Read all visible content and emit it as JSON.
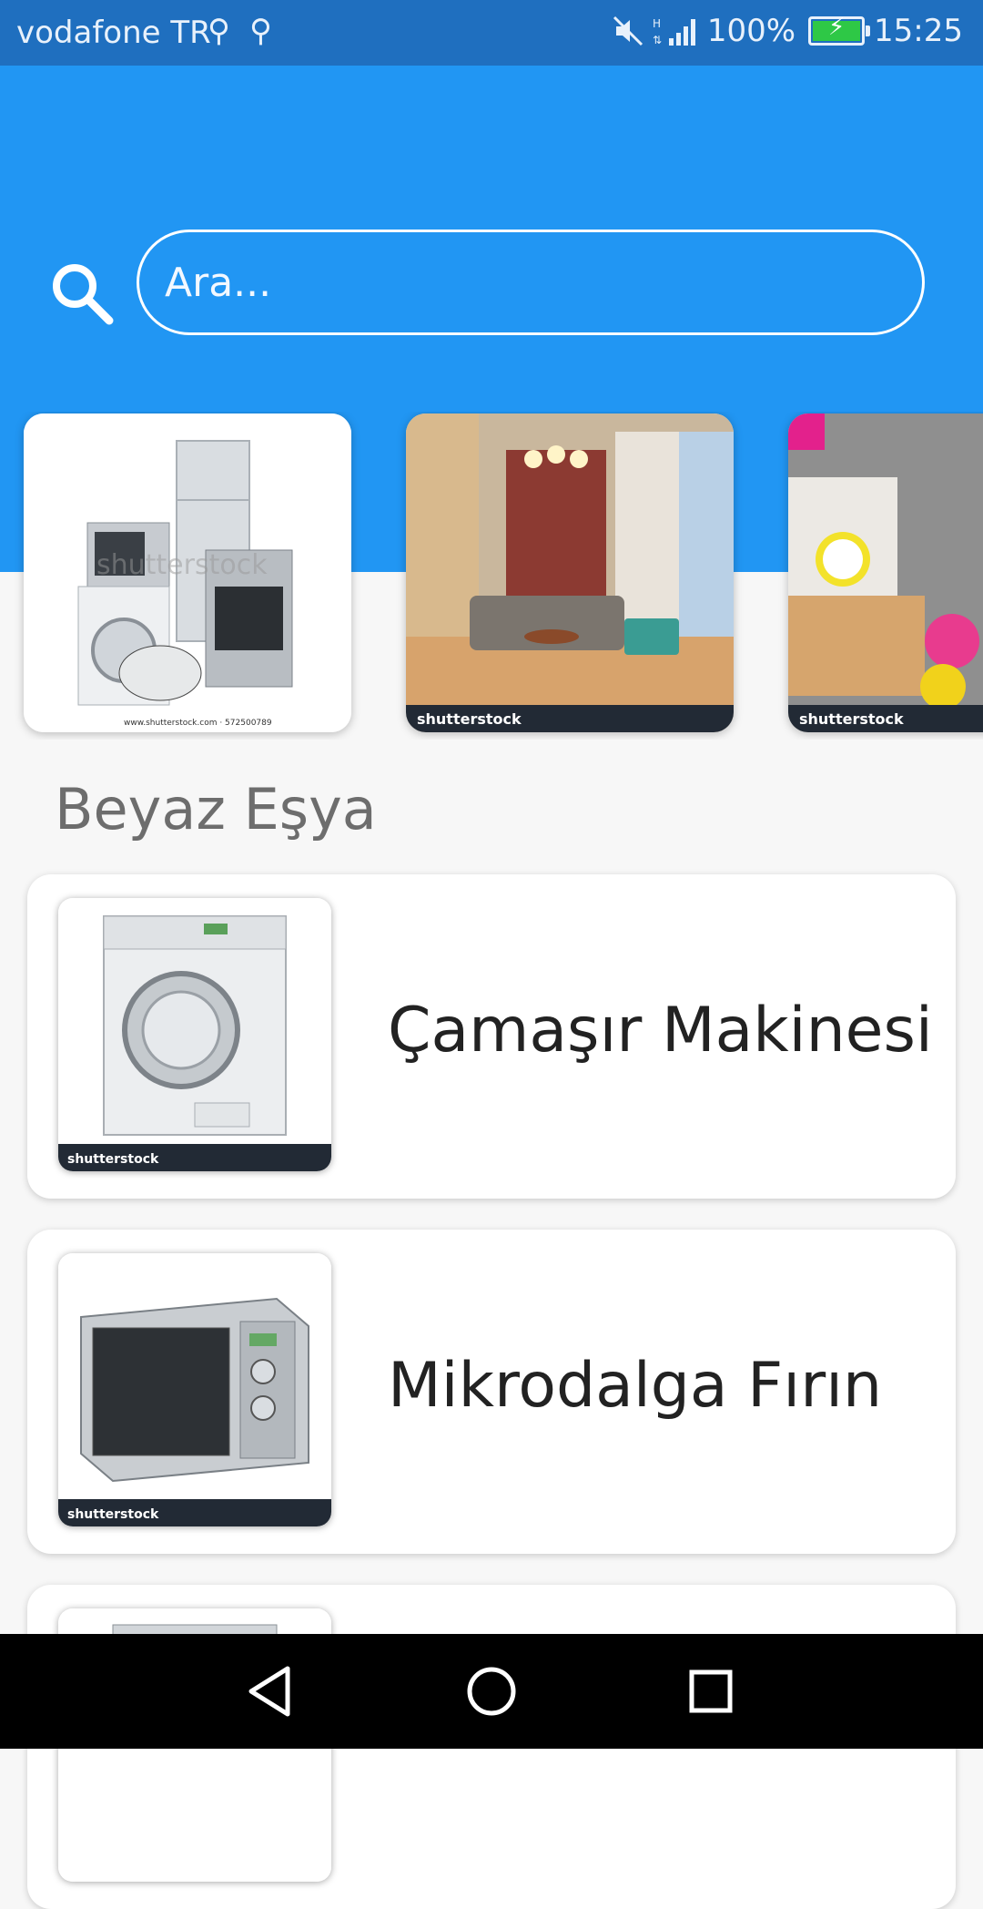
{
  "status_bar": {
    "carrier": "vodafone TR",
    "battery_percent": "100%",
    "time": "15:25"
  },
  "search": {
    "placeholder": "Ara..."
  },
  "carousel": {
    "watermark": "shutterstock",
    "first_caption": "www.shutterstock.com · 572500789"
  },
  "section": {
    "title": "Beyaz Eşya"
  },
  "items": [
    {
      "label": "Çamaşır Makinesi"
    },
    {
      "label": "Mikrodalga Fırın"
    },
    {
      "label": ""
    }
  ],
  "colors": {
    "accent": "#2196f3",
    "status_bar": "#1f6fbf",
    "background": "#f7f7f7"
  },
  "icons": [
    "usb-icon",
    "mute-icon",
    "signal-icon",
    "battery-icon",
    "search-icon",
    "back-icon",
    "home-icon",
    "recents-icon"
  ]
}
